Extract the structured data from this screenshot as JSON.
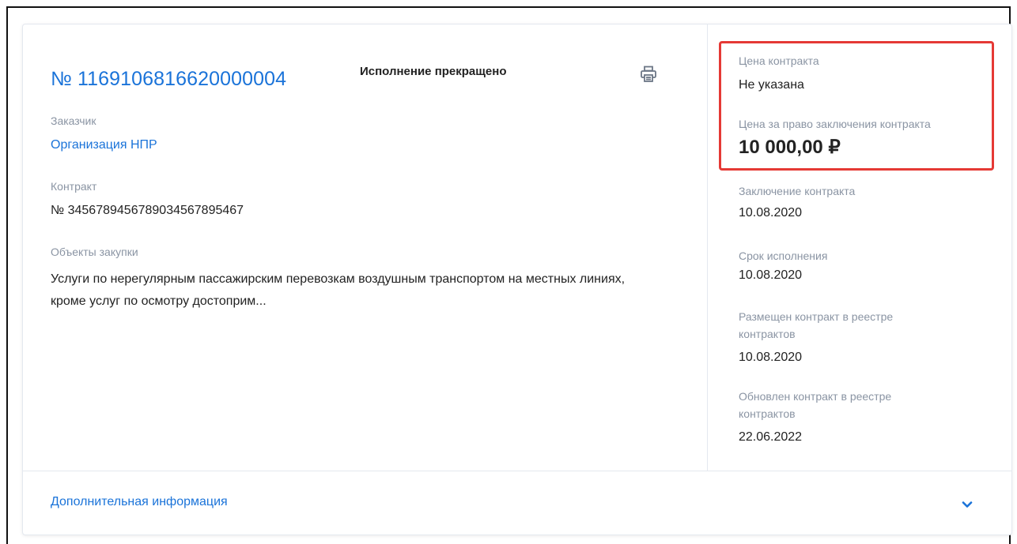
{
  "card": {
    "title": "№ 1169106816620000004",
    "status": "Исполнение прекращено",
    "customer": {
      "label": "Заказчик",
      "value": "Организация НПР"
    },
    "contract": {
      "label": "Контракт",
      "value": "№ 3456789456789034567895467"
    },
    "objects": {
      "label": "Объекты закупки",
      "value": "Услуги по нерегулярным пассажирским перевозкам воздушным транспортом на местных линиях, кроме услуг по осмотру достоприм..."
    }
  },
  "side": {
    "contract_price": {
      "label": "Цена контракта",
      "value": "Не указана"
    },
    "right_price": {
      "label": "Цена за право заключения контракта",
      "value": "10 000,00 ₽"
    },
    "conclusion": {
      "label": "Заключение контракта",
      "value": "10.08.2020"
    },
    "deadline": {
      "label": "Срок исполнения",
      "value": "10.08.2020"
    },
    "placed": {
      "label": "Размещен контракт в реестре контрактов",
      "value": "10.08.2020"
    },
    "updated": {
      "label": "Обновлен контракт в реестре контрактов",
      "value": "22.06.2022"
    }
  },
  "footer": {
    "more_label": "Дополнительная информация"
  },
  "colors": {
    "accent": "#1a73d9",
    "highlight": "#e53935",
    "label": "#8a94a3",
    "text": "#222222"
  },
  "icons": {
    "print": "printer-icon",
    "expand": "chevron-down-icon"
  }
}
